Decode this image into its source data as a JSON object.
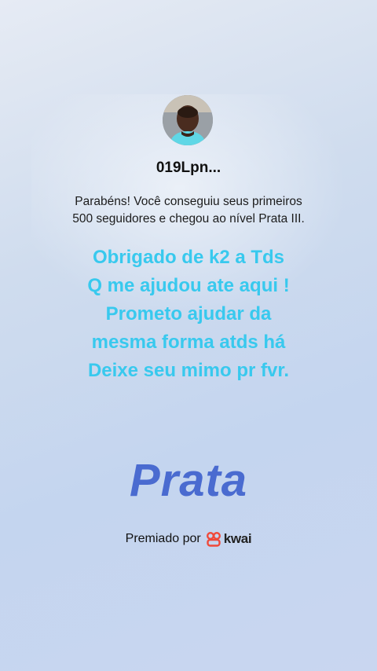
{
  "profile": {
    "username": "019Lpn..."
  },
  "achievement": {
    "message_line1": "Parabéns! Você conseguiu seus primeiros",
    "message_line2": "500 seguidores e chegou ao nível Prata III.",
    "level_name": "Prata"
  },
  "overlay_text": {
    "lines": [
      "Obrigado de k2 a Tds",
      "Q me ajudou ate aqui !",
      "Prometo ajudar da",
      "mesma forma atds há",
      "Deixe seu mimo pr fvr."
    ]
  },
  "footer": {
    "awarded_by_label": "Premiado por",
    "brand_name": "kwai",
    "brand_icon": "kwai-logo-icon"
  },
  "colors": {
    "overlay_text": "#38c9ee",
    "level_text": "#4a6bd0",
    "brand_icon": "#f0493a"
  }
}
